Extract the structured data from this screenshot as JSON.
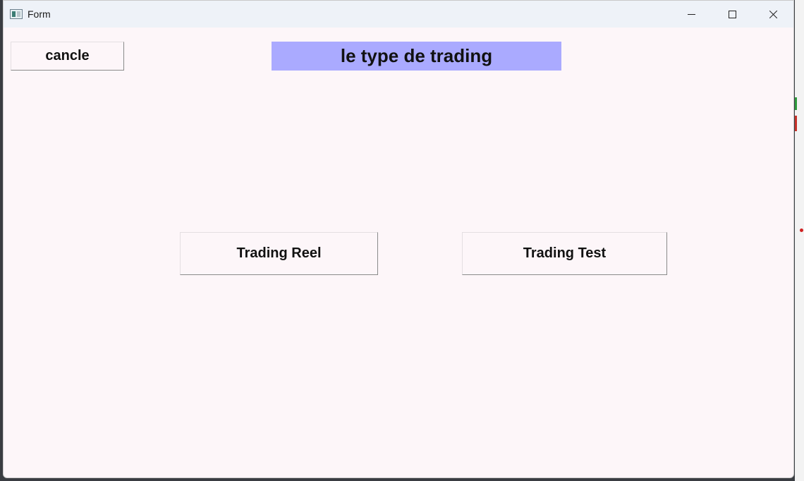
{
  "window": {
    "title": "Form"
  },
  "form": {
    "cancel_label": "cancle",
    "heading": "le type de trading",
    "trading_reel_label": "Trading Reel",
    "trading_test_label": "Trading Test"
  },
  "colors": {
    "heading_background": "#aaaaff",
    "window_background": "#fdf6f9",
    "titlebar_background": "#eef2f8"
  },
  "icons": {
    "app": "app-window-icon",
    "minimize": "minimize-icon",
    "maximize": "maximize-icon",
    "close": "close-icon"
  }
}
